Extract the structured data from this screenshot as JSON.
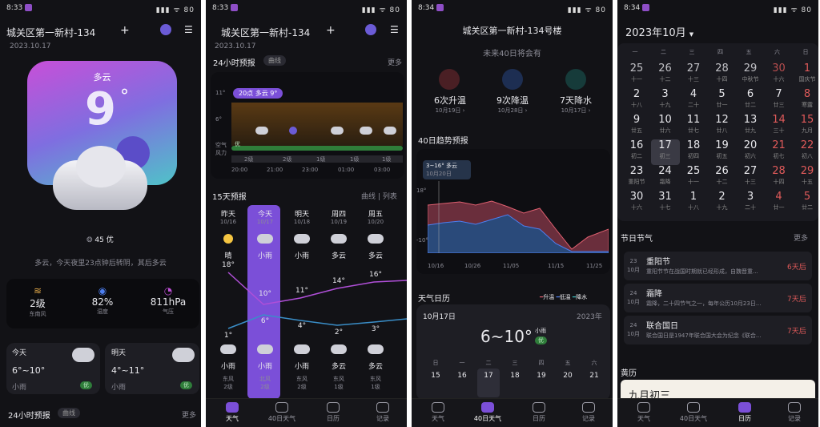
{
  "screen1": {
    "status_time": "8:33",
    "status_icons": "▮▮▮ ᯤ 80",
    "location": "城关区第一新村-134",
    "date": "2023.10.17",
    "hero_condition": "多云",
    "hero_temp": "9",
    "hero_degree": "°",
    "aqi_value": "45",
    "aqi_label": "优",
    "summary": "多云，今天夜里23点钟后转阴，其后多云",
    "metrics": [
      {
        "value": "2级",
        "label": "东南风"
      },
      {
        "value": "82%",
        "label": "湿度"
      },
      {
        "value": "811hPa",
        "label": "气压"
      }
    ],
    "today": {
      "label": "今天",
      "range": "6°~10°",
      "cond": "小雨",
      "aqi": "优"
    },
    "tomorrow": {
      "label": "明天",
      "range": "4°~11°",
      "cond": "小雨",
      "aqi": "优"
    },
    "forecast_title": "24小时预报",
    "forecast_pill": "曲线",
    "more": "更多"
  },
  "screen2": {
    "status_time": "8:33",
    "location": "城关区第一新村-134",
    "date": "2023.10.17",
    "h24_title": "24小时预报",
    "h24_pill": "曲线",
    "more": "更多",
    "tooltip": "20点 多云 9°",
    "y_labels": [
      "11°",
      "6°"
    ],
    "row_labels": [
      "空气",
      "风力"
    ],
    "aqi_good": "优",
    "wind_levels": [
      "2级",
      "2级",
      "1级",
      "1级",
      "1级"
    ],
    "times": [
      "20:00",
      "21:00",
      "23:00",
      "01:00",
      "03:00"
    ],
    "d15_title": "15天预报",
    "d15_toggle_a": "曲线",
    "d15_toggle_sep": "|",
    "d15_toggle_b": "列表",
    "days": [
      {
        "name": "昨天",
        "date": "10/16",
        "cond": "晴",
        "high": "18°",
        "low": "1°",
        "ncond": "小雨",
        "wind": "东风",
        "level": "2级"
      },
      {
        "name": "今天",
        "date": "10/17",
        "cond": "小雨",
        "high": "10°",
        "low": "6°",
        "ncond": "小雨",
        "wind": "北风",
        "level": "2级"
      },
      {
        "name": "明天",
        "date": "10/18",
        "cond": "小雨",
        "high": "11°",
        "low": "4°",
        "ncond": "小雨",
        "wind": "东风",
        "level": "2级"
      },
      {
        "name": "周四",
        "date": "10/19",
        "cond": "多云",
        "high": "14°",
        "low": "2°",
        "ncond": "多云",
        "wind": "东风",
        "level": "1级"
      },
      {
        "name": "周五",
        "date": "10/20",
        "cond": "多云",
        "high": "16°",
        "low": "3°",
        "ncond": "多云",
        "wind": "东风",
        "level": "1级"
      }
    ]
  },
  "screen3": {
    "status_time": "8:34",
    "location": "城关区第一新村-134号楼",
    "subtitle": "未来40日将会有",
    "stats": [
      {
        "value": "6次升温",
        "date": "10月19日 ›"
      },
      {
        "value": "9次降温",
        "date": "10月28日 ›"
      },
      {
        "value": "7天降水",
        "date": "10月17日 ›"
      }
    ],
    "trend_title": "40日趋势预报",
    "trend_tip_range": "3~16°",
    "trend_tip_cond": "多云",
    "trend_tip_date": "10月20日",
    "trend_y": [
      "18°",
      "-10°"
    ],
    "trend_x": [
      "10/16",
      "10/26",
      "11/05",
      "11/15",
      "11/25"
    ],
    "cal_title": "天气日历",
    "legend": [
      "升温",
      "低温",
      "降水"
    ],
    "cal_date": "10月17日",
    "cal_year": "2023年",
    "cal_range": "6~10°",
    "cal_cond": "小雨",
    "cal_aqi": "优",
    "week_head": [
      "日",
      "一",
      "二",
      "三",
      "四",
      "五",
      "六"
    ],
    "week_days": [
      "15",
      "16",
      "17",
      "18",
      "19",
      "20",
      "21"
    ]
  },
  "screen4": {
    "status_time": "8:34",
    "month_title": "2023年10月",
    "week_head": [
      "一",
      "二",
      "三",
      "四",
      "五",
      "六",
      "日"
    ],
    "festival_title": "节日节气",
    "more": "更多",
    "festivals": [
      {
        "day": "23",
        "month": "10月",
        "name": "重阳节",
        "desc": "重阳节节在战国时期就已经形成，自魏晋重...",
        "count": "6天后"
      },
      {
        "day": "24",
        "month": "10月",
        "name": "霜降",
        "desc": "霜降，二十四节气之一，每年公历10月23日...",
        "count": "7天后"
      },
      {
        "day": "24",
        "month": "10月",
        "name": "联合国日",
        "desc": "联合国日是1947年联合国大会为纪念《联合...",
        "count": "7天后"
      }
    ],
    "almanac_title": "黄历",
    "almanac_date": "九月初三"
  },
  "calendar_rows": [
    [
      {
        "d": "25",
        "l": "十一"
      },
      {
        "d": "26",
        "l": "十二"
      },
      {
        "d": "27",
        "l": "十三"
      },
      {
        "d": "28",
        "l": "十四"
      },
      {
        "d": "29",
        "l": "中秋节"
      },
      {
        "d": "30",
        "l": "十六"
      },
      {
        "d": "1",
        "l": "国庆节"
      }
    ],
    [
      {
        "d": "2",
        "l": "十八"
      },
      {
        "d": "3",
        "l": "十九"
      },
      {
        "d": "4",
        "l": "二十"
      },
      {
        "d": "5",
        "l": "廿一"
      },
      {
        "d": "6",
        "l": "廿二"
      },
      {
        "d": "7",
        "l": "廿三"
      },
      {
        "d": "8",
        "l": "寒露"
      }
    ],
    [
      {
        "d": "9",
        "l": "廿五"
      },
      {
        "d": "10",
        "l": "廿六"
      },
      {
        "d": "11",
        "l": "廿七"
      },
      {
        "d": "12",
        "l": "廿八"
      },
      {
        "d": "13",
        "l": "廿九"
      },
      {
        "d": "14",
        "l": "三十"
      },
      {
        "d": "15",
        "l": "九月"
      }
    ],
    [
      {
        "d": "16",
        "l": "初二"
      },
      {
        "d": "17",
        "l": "初三"
      },
      {
        "d": "18",
        "l": "初四"
      },
      {
        "d": "19",
        "l": "初五"
      },
      {
        "d": "20",
        "l": "初六"
      },
      {
        "d": "21",
        "l": "初七"
      },
      {
        "d": "22",
        "l": "初八"
      }
    ],
    [
      {
        "d": "23",
        "l": "重阳节"
      },
      {
        "d": "24",
        "l": "霜降"
      },
      {
        "d": "25",
        "l": "十一"
      },
      {
        "d": "26",
        "l": "十二"
      },
      {
        "d": "27",
        "l": "十三"
      },
      {
        "d": "28",
        "l": "十四"
      },
      {
        "d": "29",
        "l": "十五"
      }
    ],
    [
      {
        "d": "30",
        "l": "十六"
      },
      {
        "d": "31",
        "l": "十七"
      },
      {
        "d": "1",
        "l": "十八"
      },
      {
        "d": "2",
        "l": "十九"
      },
      {
        "d": "3",
        "l": "二十"
      },
      {
        "d": "4",
        "l": "廿一"
      },
      {
        "d": "5",
        "l": "廿二"
      }
    ]
  ],
  "tabs": [
    "天气",
    "40日天气",
    "日历",
    "记录"
  ],
  "colors": {
    "accent": "#7b4fd8",
    "red": "#e05a5a",
    "good": "#2f7d3a"
  }
}
